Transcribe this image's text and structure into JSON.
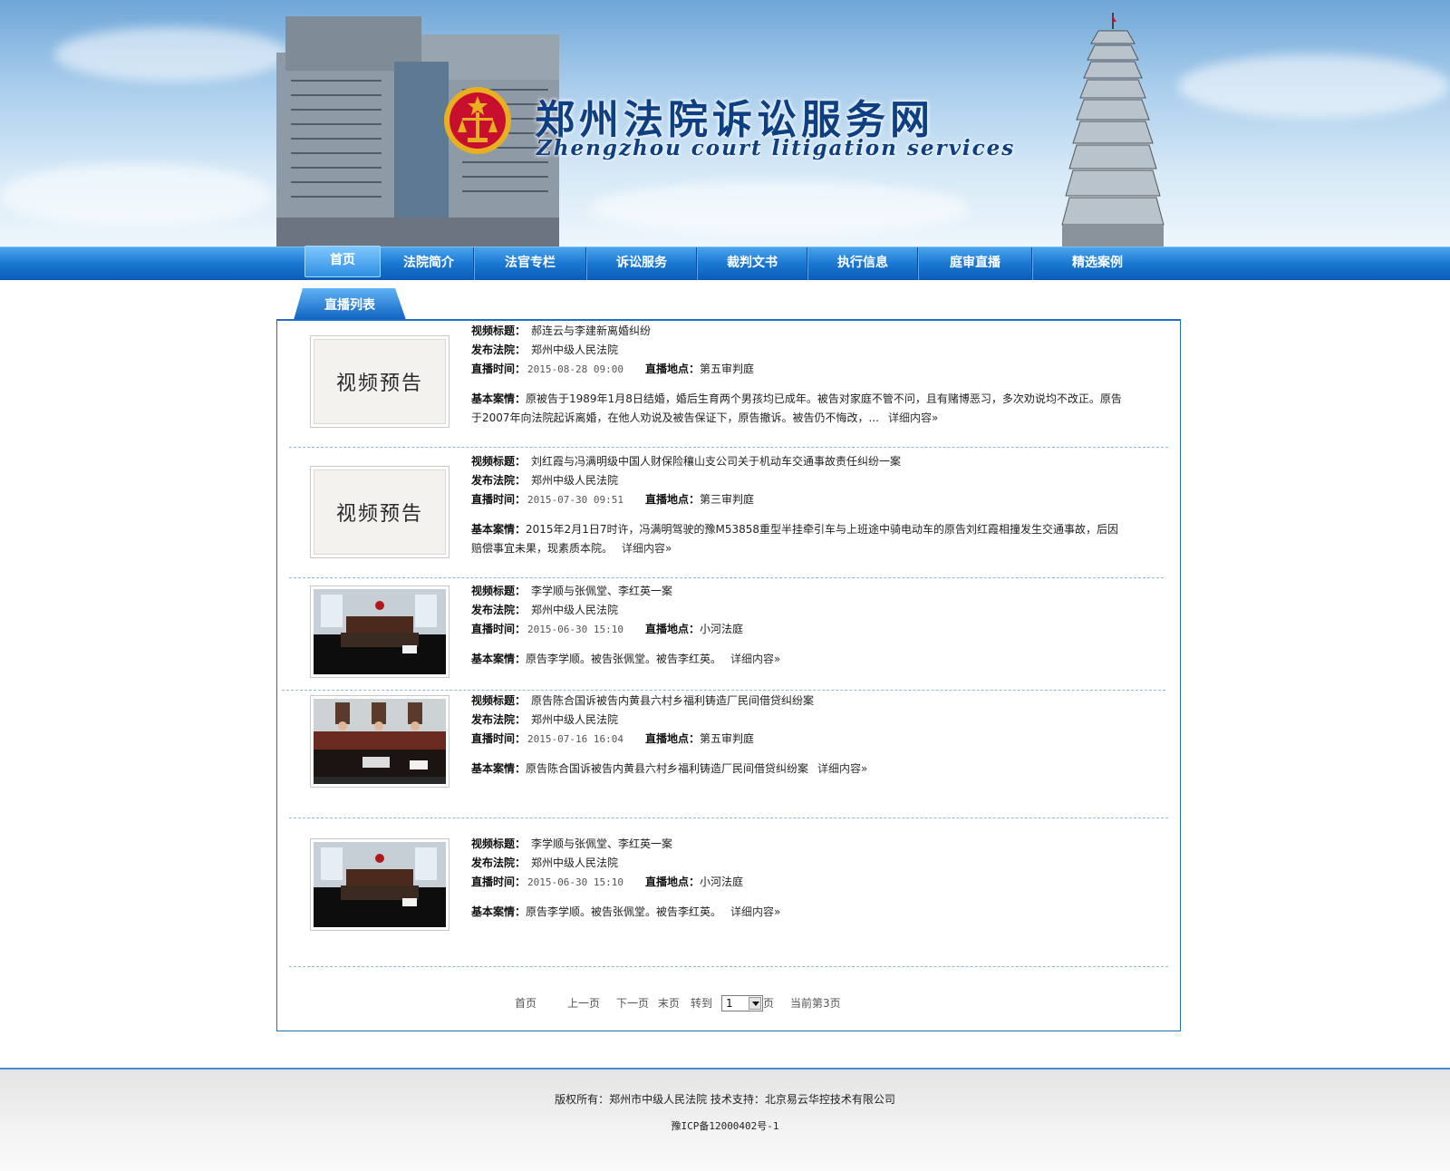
{
  "header": {
    "title": "郑州法院诉讼服务网",
    "subtitle": "Zhengzhou court litigation services"
  },
  "nav": {
    "items": [
      "首页",
      "法院简介",
      "法官专栏",
      "诉讼服务",
      "裁判文书",
      "执行信息",
      "庭审直播",
      "精选案例"
    ],
    "active": "首页"
  },
  "section": {
    "tab_label": "直播列表"
  },
  "labels": {
    "title": "视频标题：",
    "court": "发布法院：",
    "time": "直播时间：",
    "location": "直播地点：",
    "summary": "基本案情：",
    "more": "详细内容»",
    "preview_text": "视频预告"
  },
  "videos": [
    {
      "title": "郝连云与李建新离婚纠纷",
      "court": "郑州中级人民法院",
      "time": "2015-08-28 09:00",
      "location": "第五审判庭",
      "summary": "原被告于1989年1月8日结婚，婚后生育两个男孩均已成年。被告对家庭不管不问，且有赌博恶习，多次劝说均不改正。原告于2007年向法院起诉离婚，在他人劝说及被告保证下，原告撤诉。被告仍不悔改，...",
      "thumb": "preview"
    },
    {
      "title": "刘红霞与冯满明级中国人财保险穰山支公司关于机动车交通事故责任纠纷一案",
      "court": "郑州中级人民法院",
      "time": "2015-07-30 09:51",
      "location": "第三审判庭",
      "summary": "2015年2月1日7时许，冯满明驾驶的豫M53858重型半挂牵引车与上班途中骑电动车的原告刘红霞相撞发生交通事故，后因赔偿事宜未果，现素质本院。",
      "thumb": "preview"
    },
    {
      "title": "李学顺与张佩堂、李红英一案",
      "court": "郑州中级人民法院",
      "time": "2015-06-30 15:10",
      "location": "小河法庭",
      "summary": "原告李学顺。被告张佩堂。被告李红英。",
      "thumb": "courtroom-a"
    },
    {
      "title": "原告陈合国诉被告内黄县六村乡福利铸造厂民间借贷纠纷案",
      "court": "郑州中级人民法院",
      "time": "2015-07-16 16:04",
      "location": "第五审判庭",
      "summary": "原告陈合国诉被告内黄县六村乡福利铸造厂民间借贷纠纷案",
      "thumb": "courtroom-b"
    },
    {
      "title": "李学顺与张佩堂、李红英一案",
      "court": "郑州中级人民法院",
      "time": "2015-06-30 15:10",
      "location": "小河法庭",
      "summary": "原告李学顺。被告张佩堂。被告李红英。",
      "thumb": "courtroom-a"
    }
  ],
  "pager": {
    "first": "首页",
    "prev": "上一页",
    "next": "下一页",
    "last": "末页",
    "goto": "转到",
    "page_value": "1",
    "page_unit": "页",
    "current": "当前第3页"
  },
  "footer": {
    "copyright": "版权所有：郑州市中级人民法院   技术支持：北京易云华控技术有限公司",
    "icp": "豫ICP备12000402号-1"
  },
  "colors": {
    "nav_blue": "#1a78d2",
    "title_blue": "#0d3f82",
    "border_blue": "#1f6fc7",
    "emblem_red": "#c8102e",
    "emblem_gold": "#e8b020"
  }
}
